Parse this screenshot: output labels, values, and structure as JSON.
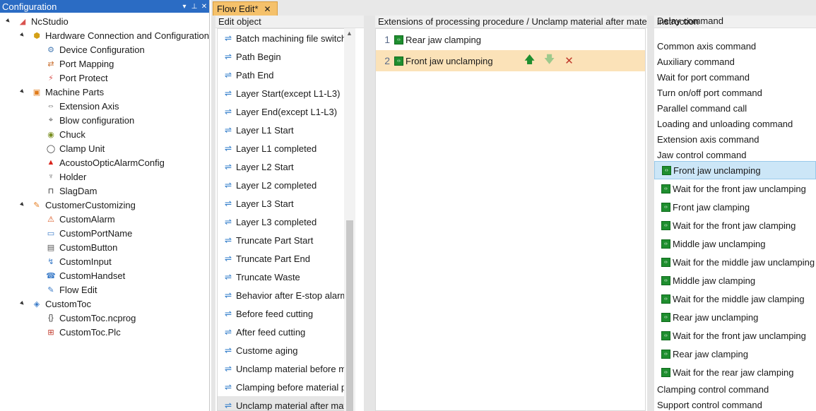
{
  "left_panel": {
    "title": "Configuration",
    "pin_icon": "pin-icon",
    "close_icon": "close-icon",
    "dropdown_icon": "dropdown-icon"
  },
  "tree": [
    {
      "label": "NcStudio",
      "level": 0,
      "toggle": "▲",
      "icon": "ncstudio-icon"
    },
    {
      "label": "Hardware Connection and Configuration",
      "level": 1,
      "toggle": "▲",
      "icon": "hardware-icon"
    },
    {
      "label": "Device Configuration",
      "level": 2,
      "toggle": "",
      "icon": "device-icon"
    },
    {
      "label": "Port Mapping",
      "level": 2,
      "toggle": "",
      "icon": "port-mapping-icon"
    },
    {
      "label": "Port Protect",
      "level": 2,
      "toggle": "",
      "icon": "port-protect-icon"
    },
    {
      "label": "Machine Parts",
      "level": 1,
      "toggle": "▲",
      "icon": "machine-parts-icon"
    },
    {
      "label": "Extension Axis",
      "level": 2,
      "toggle": "",
      "icon": "extension-axis-icon"
    },
    {
      "label": "Blow configuration",
      "level": 2,
      "toggle": "",
      "icon": "blow-icon"
    },
    {
      "label": "Chuck",
      "level": 2,
      "toggle": "",
      "icon": "chuck-icon"
    },
    {
      "label": "Clamp Unit",
      "level": 2,
      "toggle": "",
      "icon": "clamp-unit-icon"
    },
    {
      "label": "AcoustoOpticAlarmConfig",
      "level": 2,
      "toggle": "",
      "icon": "alarm-light-icon"
    },
    {
      "label": "Holder",
      "level": 2,
      "toggle": "",
      "icon": "holder-icon"
    },
    {
      "label": "SlagDam",
      "level": 2,
      "toggle": "",
      "icon": "slagdam-icon"
    },
    {
      "label": "CustomerCustomizing",
      "level": 1,
      "toggle": "▲",
      "icon": "customizing-icon"
    },
    {
      "label": "CustomAlarm",
      "level": 2,
      "toggle": "",
      "icon": "warning-icon"
    },
    {
      "label": "CustomPortName",
      "level": 2,
      "toggle": "",
      "icon": "port-name-icon"
    },
    {
      "label": "CustomButton",
      "level": 2,
      "toggle": "",
      "icon": "button-icon"
    },
    {
      "label": "CustomInput",
      "level": 2,
      "toggle": "",
      "icon": "input-icon"
    },
    {
      "label": "CustomHandset",
      "level": 2,
      "toggle": "",
      "icon": "handset-icon"
    },
    {
      "label": "Flow Edit",
      "level": 2,
      "toggle": "",
      "icon": "flow-edit-icon"
    },
    {
      "label": "CustomToc",
      "level": 1,
      "toggle": "▲",
      "icon": "customtoc-icon"
    },
    {
      "label": "CustomToc.ncprog",
      "level": 2,
      "toggle": "",
      "icon": "ncprog-file-icon"
    },
    {
      "label": "CustomToc.Plc",
      "level": 2,
      "toggle": "",
      "icon": "plc-file-icon"
    }
  ],
  "tab": {
    "label": "Flow Edit*",
    "close": "✕"
  },
  "edit_object": {
    "header": "Edit object",
    "items": [
      "Batch machining file switching",
      "Path Begin",
      "Path End",
      "Layer Start(except L1-L3)",
      "Layer End(except L1-L3)",
      "Layer L1 Start",
      "Layer L1 completed",
      "Layer L2 Start",
      "Layer L2 completed",
      "Layer L3 Start",
      "Layer L3 completed",
      "Truncate Part Start",
      "Truncate Part End",
      "Truncate Waste",
      "Behavior after E-stop alarm",
      "Before feed cutting",
      "After feed cutting",
      "Custome aging",
      "Unclamp material before machining",
      "Clamping before material processing",
      "Unclamp material after material processing"
    ],
    "selected_index": 20
  },
  "procedure": {
    "header": "Extensions of processing procedure / Unclamp material after material processing",
    "lines": [
      {
        "num": "1",
        "text": "Rear jaw clamping"
      },
      {
        "num": "2",
        "text": "Front jaw unclamping"
      }
    ],
    "highlighted_line": 1,
    "actions": {
      "up": "🡅",
      "down": "🡇",
      "delete": "✕"
    }
  },
  "instruction": {
    "header": "instruction",
    "groups": [
      "Delay command",
      "Common axis command",
      "Auxiliary command",
      "Wait for port command",
      "Turn on/off port command",
      "Parallel command call",
      "Loading and unloading command",
      "Extension axis command",
      "Jaw control command"
    ],
    "sub_items": [
      "Front jaw unclamping",
      "Wait for the front jaw unclamping",
      "Front jaw clamping",
      "Wait for the front jaw clamping",
      "Middle jaw unclamping",
      "Wait for the middle jaw unclamping",
      "Middle jaw clamping",
      "Wait for the middle jaw clamping",
      "Rear jaw unclamping",
      "Wait for the front jaw unclamping",
      "Rear jaw clamping",
      "Wait for the rear jaw clamping"
    ],
    "selected_sub": 0,
    "after": [
      "Clamping control command",
      "Support control command"
    ]
  },
  "colors": {
    "header_blue": "#2b6cc4",
    "tab_orange": "#f5c16b",
    "highlight_line": "#fbe2b8",
    "selected_instruction": "#cce6f7",
    "jaw_icon_green": "#1f8e2f",
    "up_arrow": "#1f8e2f",
    "down_arrow": "#9dc98c",
    "delete_red": "#c0392b"
  }
}
